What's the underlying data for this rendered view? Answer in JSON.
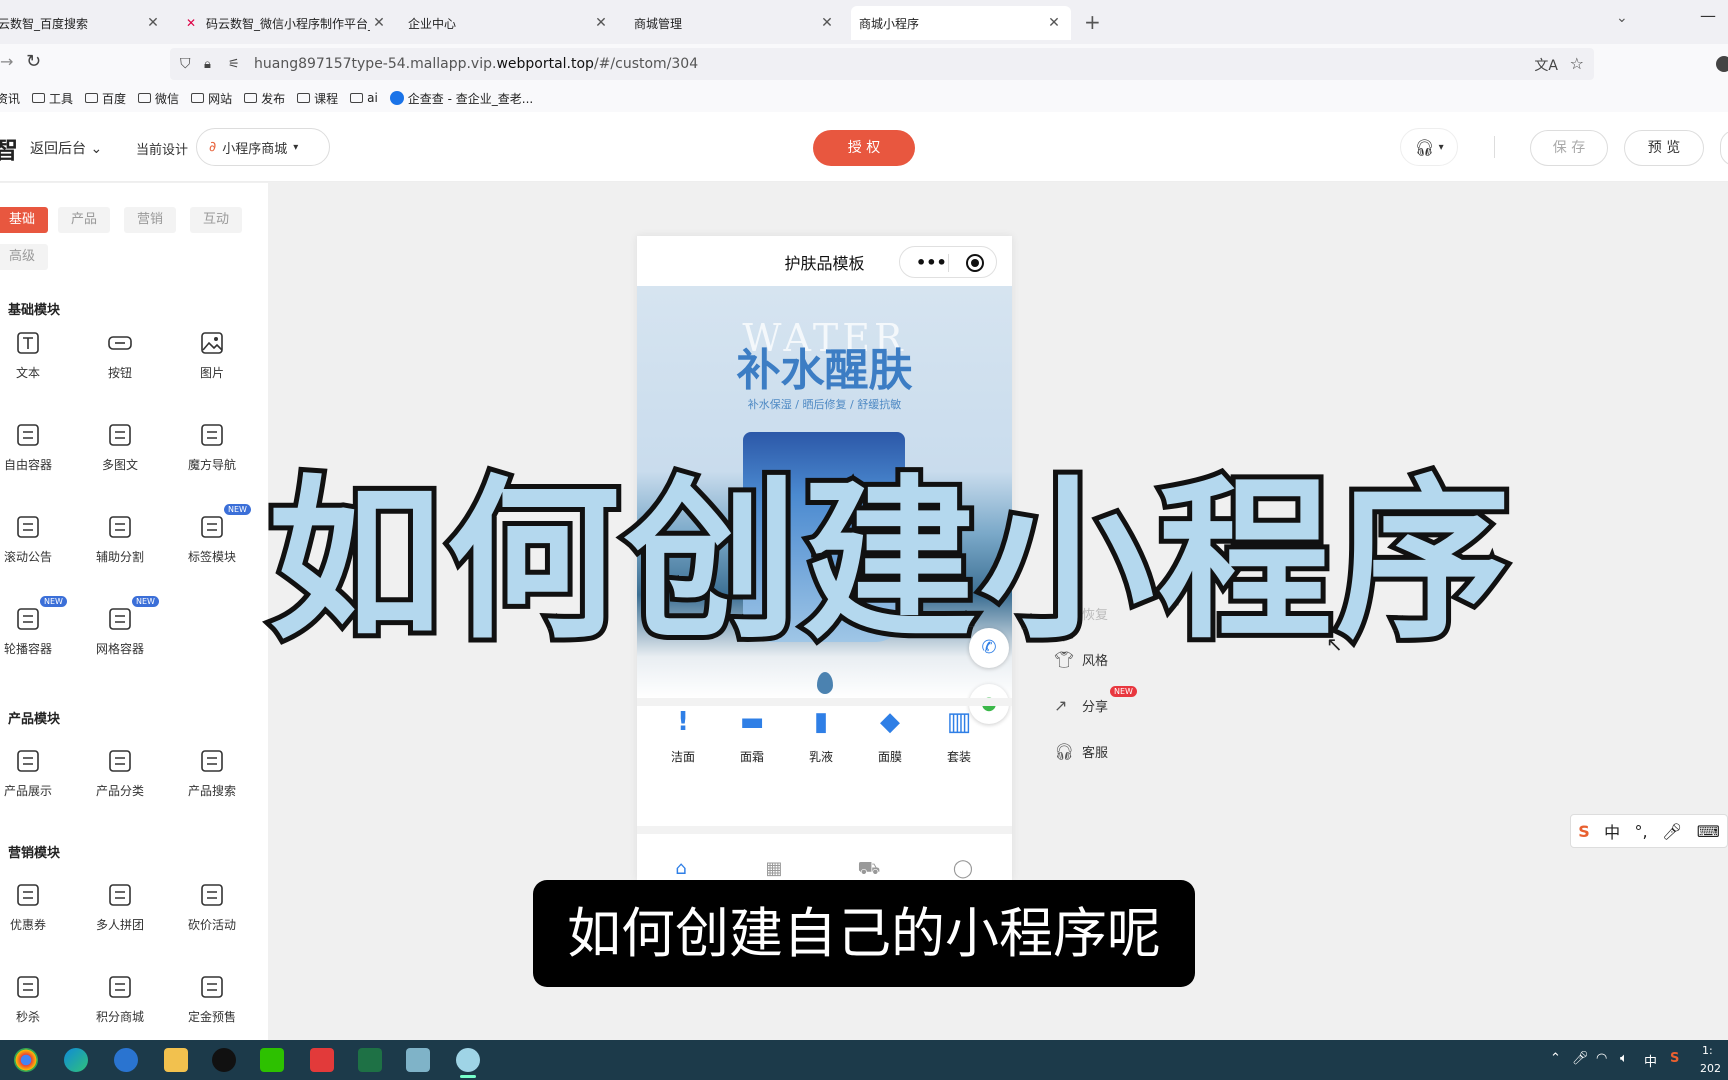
{
  "browser": {
    "tabs": [
      {
        "title": "云数智_百度搜索",
        "active": false
      },
      {
        "title": "码云数智_微信小程序制作平台_",
        "active": false
      },
      {
        "title": "企业中心",
        "active": false
      },
      {
        "title": "商城管理",
        "active": false
      },
      {
        "title": "商城小程序",
        "active": true
      }
    ],
    "new_tab": "+",
    "url_prefix": "huang897157type-54.mallapp.vip.",
    "url_domain": "webportal.top",
    "url_suffix": "/#/custom/304",
    "bookmarks": [
      "资讯",
      "工具",
      "百度",
      "微信",
      "网站",
      "发布",
      "课程",
      "ai",
      "企查查 - 查企业_查老..."
    ]
  },
  "header": {
    "logo_char": "智",
    "back_label": "返回后台",
    "current_design_label": "当前设计",
    "design_name": "小程序商城",
    "auth_label": "授 权",
    "save_label": "保 存",
    "preview_label": "预 览"
  },
  "sidebar": {
    "category_tabs": [
      "基础",
      "产品",
      "营销",
      "互动",
      "高级"
    ],
    "sections": [
      {
        "title": "基础模块",
        "items": [
          {
            "label": "文本",
            "icon": "text-icon"
          },
          {
            "label": "按钮",
            "icon": "button-icon"
          },
          {
            "label": "图片",
            "icon": "image-icon"
          },
          {
            "label": "自由容器",
            "icon": "free-container-icon"
          },
          {
            "label": "多图文",
            "icon": "multi-image-icon"
          },
          {
            "label": "魔方导航",
            "icon": "cube-nav-icon"
          },
          {
            "label": "滚动公告",
            "icon": "notice-icon"
          },
          {
            "label": "辅助分割",
            "icon": "divider-icon"
          },
          {
            "label": "标签模块",
            "icon": "tag-icon",
            "badge": "NEW"
          },
          {
            "label": "轮播容器",
            "icon": "carousel-icon",
            "badge": "NEW"
          },
          {
            "label": "网格容器",
            "icon": "grid-icon",
            "badge": "NEW"
          }
        ]
      },
      {
        "title": "产品模块",
        "items": [
          {
            "label": "产品展示",
            "icon": "product-display-icon"
          },
          {
            "label": "产品分类",
            "icon": "product-category-icon"
          },
          {
            "label": "产品搜索",
            "icon": "product-search-icon"
          }
        ]
      },
      {
        "title": "营销模块",
        "items": [
          {
            "label": "优惠券",
            "icon": "coupon-icon"
          },
          {
            "label": "多人拼团",
            "icon": "group-buy-icon"
          },
          {
            "label": "砍价活动",
            "icon": "bargain-icon"
          },
          {
            "label": "秒杀",
            "icon": "flash-sale-icon"
          },
          {
            "label": "积分商城",
            "icon": "points-mall-icon"
          },
          {
            "label": "定金预售",
            "icon": "presale-icon"
          }
        ]
      }
    ]
  },
  "phone": {
    "title": "护肤品模板",
    "banner_watermark": "WATER",
    "banner_title": "补水醒肤",
    "banner_subtitle": "补水保湿 / 晒后修复 / 舒缓抗敏",
    "categories": [
      "洁面",
      "面霜",
      "乳液",
      "面膜",
      "套装"
    ]
  },
  "right_menu": [
    {
      "label": "恢复",
      "icon": "redo-icon",
      "disabled": true
    },
    {
      "label": "风格",
      "icon": "shirt-icon",
      "disabled": false
    },
    {
      "label": "分享",
      "icon": "share-icon",
      "disabled": false,
      "badge": "NEW"
    },
    {
      "label": "客服",
      "icon": "headset-icon",
      "disabled": false
    }
  ],
  "ime": {
    "logo": "S",
    "mode": "中",
    "punct": "°,"
  },
  "overlay": {
    "title": "如何创建小程序",
    "subtitle": "如何创建自己的小程序呢"
  },
  "taskbar": {
    "lang": "中",
    "time_partial": "1:",
    "date_partial": "202"
  }
}
